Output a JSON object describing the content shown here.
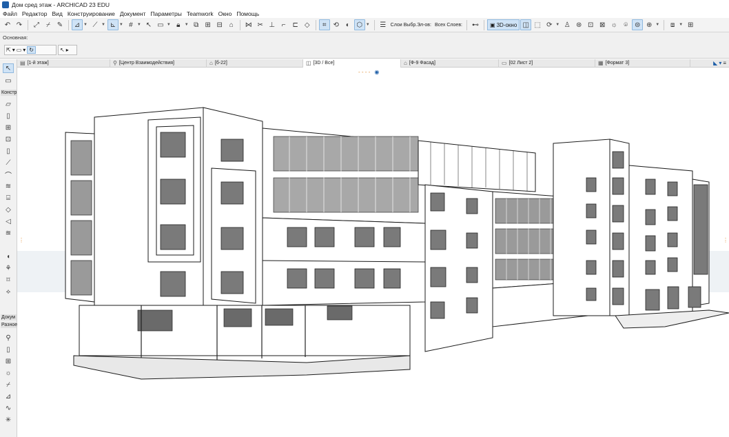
{
  "window": {
    "title": "Дом сред этаж - ARCHICAD 23 EDU"
  },
  "menu": [
    "Файл",
    "Редактор",
    "Вид",
    "Конструирование",
    "Документ",
    "Параметры",
    "Teamwork",
    "Окно",
    "Помощь"
  ],
  "toolbar": {
    "layers_label_1": "Слои Выбр.Эл-ов:",
    "layers_label_2": "Всех Слоев:",
    "window_3d_label": "3D-окно"
  },
  "infobox": {
    "basic_label": "Основная:"
  },
  "tabs": [
    {
      "label": "[1-й этаж]",
      "icon": "floor-plan-icon"
    },
    {
      "label": "[Центр Взаимодействия]",
      "icon": "interaction-center-icon"
    },
    {
      "label": "[б-22]",
      "icon": "section-icon"
    },
    {
      "label": "[3D / Все]",
      "icon": "3d-view-icon",
      "active": true
    },
    {
      "label": "[Ф-9 Фасад]",
      "icon": "elevation-icon"
    },
    {
      "label": "[02 Лист 2]",
      "icon": "layout-icon"
    },
    {
      "label": "[Формат 3]",
      "icon": "worksheet-icon"
    }
  ],
  "toolbox": {
    "sections": [
      "Констр",
      "Докум",
      "Разное"
    ]
  },
  "colors": {
    "accent": "#1f5fa8",
    "active_bg": "#cfe3f6",
    "marker": "#e08a2c"
  }
}
